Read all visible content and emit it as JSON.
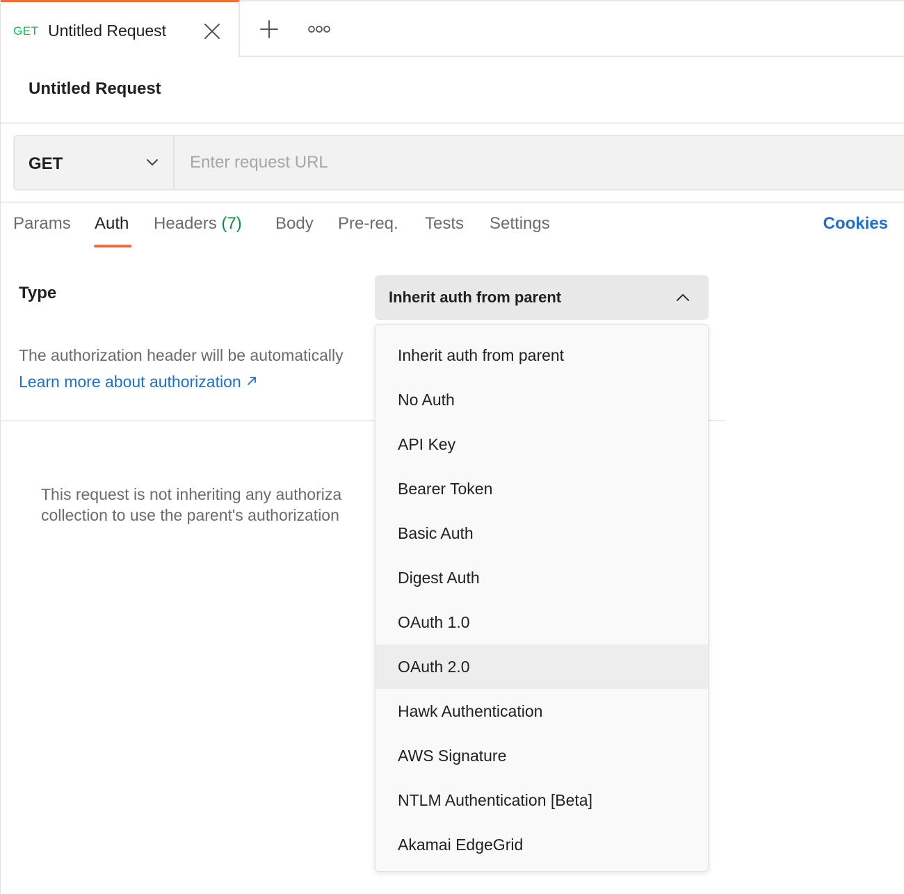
{
  "tab": {
    "method": "GET",
    "title": "Untitled Request"
  },
  "request": {
    "name": "Untitled Request",
    "method": "GET",
    "url_placeholder": "Enter request URL",
    "url_value": ""
  },
  "request_tabs": {
    "params": "Params",
    "auth": "Auth",
    "headers": "Headers",
    "headers_count": "(7)",
    "body": "Body",
    "prereq": "Pre-req.",
    "tests": "Tests",
    "settings": "Settings",
    "active": "Auth",
    "cookies": "Cookies"
  },
  "auth": {
    "type_label": "Type",
    "selected_type": "Inherit auth from parent",
    "description": "The authorization header will be automatically",
    "learn_more": "Learn more about authorization",
    "not_inheriting_line1": "This request is not inheriting any authoriza",
    "not_inheriting_line2": "collection to use the parent's authorization"
  },
  "auth_type_options": [
    "Inherit auth from parent",
    "No Auth",
    "API Key",
    "Bearer Token",
    "Basic Auth",
    "Digest Auth",
    "OAuth 1.0",
    "OAuth 2.0",
    "Hawk Authentication",
    "AWS Signature",
    "NTLM Authentication [Beta]",
    "Akamai EdgeGrid"
  ],
  "hovered_option": "OAuth 2.0",
  "icons": [
    "close-icon",
    "plus-icon",
    "more-icon",
    "chevron-down-icon",
    "chevron-up-icon",
    "external-link-icon"
  ],
  "colors": {
    "accent": "#f26b3a",
    "get_method": "#0cbb52",
    "link": "#1f6fd1",
    "headers_count": "#0a8f3c"
  }
}
